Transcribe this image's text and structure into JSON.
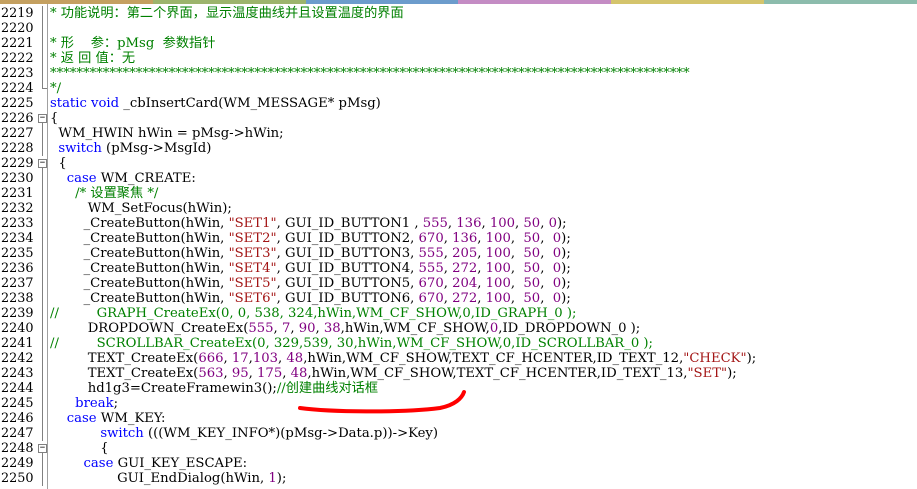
{
  "colors": {
    "comment": "#008000",
    "keyword": "#0000ff",
    "string": "#a31515",
    "number": "#800080",
    "plain": "#000000",
    "annotation": "#ff0000",
    "gutter_line": "#808080"
  },
  "top_strip_colors": [
    "#c4a060",
    "#9cb46c",
    "#6c9ccc",
    "#c48cc4",
    "#d4c46c",
    "#8cbcac"
  ],
  "lines": [
    {
      "n": "2219",
      "fold": "line",
      "segs": [
        [
          "* 功能说明：第二个界面，显示温度曲线并且设置温度的界面",
          "com"
        ]
      ]
    },
    {
      "n": "2220",
      "fold": "line",
      "segs": []
    },
    {
      "n": "2221",
      "fold": "line",
      "segs": [
        [
          "* 形    参：pMsg  参数指针",
          "com"
        ]
      ]
    },
    {
      "n": "2222",
      "fold": "line",
      "segs": [
        [
          "* 返 回 值：无",
          "com"
        ]
      ]
    },
    {
      "n": "2223",
      "fold": "line",
      "segs": [
        [
          "*************************************************************************************************",
          "com"
        ]
      ]
    },
    {
      "n": "2224",
      "fold": "end",
      "segs": [
        [
          "*/",
          "com"
        ]
      ]
    },
    {
      "n": "2225",
      "fold": "none",
      "segs": [
        [
          "static void ",
          "kw"
        ],
        [
          "_cbInsertCard(WM_MESSAGE* pMsg)",
          "pl"
        ]
      ]
    },
    {
      "n": "2226",
      "fold": "box",
      "segs": [
        [
          "{",
          "pl"
        ]
      ]
    },
    {
      "n": "2227",
      "fold": "line",
      "segs": [
        [
          "  WM_HWIN hWin = pMsg->hWin;",
          "pl"
        ]
      ]
    },
    {
      "n": "2228",
      "fold": "line",
      "segs": [
        [
          "  ",
          "pl"
        ],
        [
          "switch ",
          "kw"
        ],
        [
          "(pMsg->MsgId)",
          "pl"
        ]
      ]
    },
    {
      "n": "2229",
      "fold": "box",
      "segs": [
        [
          "  {",
          "pl"
        ]
      ]
    },
    {
      "n": "2230",
      "fold": "line",
      "segs": [
        [
          "    ",
          "pl"
        ],
        [
          "case ",
          "kw"
        ],
        [
          "WM_CREATE:",
          "pl"
        ]
      ]
    },
    {
      "n": "2231",
      "fold": "line",
      "segs": [
        [
          "      /* 设置聚焦 */",
          "com"
        ]
      ]
    },
    {
      "n": "2232",
      "fold": "line",
      "segs": [
        [
          "         WM_SetFocus(hWin);",
          "pl"
        ]
      ]
    },
    {
      "n": "2233",
      "fold": "line",
      "segs": [
        [
          "        _CreateButton(hWin, ",
          "pl"
        ],
        [
          "\"SET1\"",
          "str"
        ],
        [
          ", GUI_ID_BUTTON1 , ",
          "pl"
        ],
        [
          "555",
          "num"
        ],
        [
          ", ",
          "pl"
        ],
        [
          "136",
          "num"
        ],
        [
          ", ",
          "pl"
        ],
        [
          "100",
          "num"
        ],
        [
          ", ",
          "pl"
        ],
        [
          "50",
          "num"
        ],
        [
          ", ",
          "pl"
        ],
        [
          "0",
          "num"
        ],
        [
          ");",
          "pl"
        ]
      ]
    },
    {
      "n": "2234",
      "fold": "line",
      "segs": [
        [
          "        _CreateButton(hWin, ",
          "pl"
        ],
        [
          "\"SET2\"",
          "str"
        ],
        [
          ", GUI_ID_BUTTON2, ",
          "pl"
        ],
        [
          "670",
          "num"
        ],
        [
          ", ",
          "pl"
        ],
        [
          "136",
          "num"
        ],
        [
          ", ",
          "pl"
        ],
        [
          "100",
          "num"
        ],
        [
          ",  ",
          "pl"
        ],
        [
          "50",
          "num"
        ],
        [
          ",  ",
          "pl"
        ],
        [
          "0",
          "num"
        ],
        [
          ");",
          "pl"
        ]
      ]
    },
    {
      "n": "2235",
      "fold": "line",
      "segs": [
        [
          "        _CreateButton(hWin, ",
          "pl"
        ],
        [
          "\"SET3\"",
          "str"
        ],
        [
          ", GUI_ID_BUTTON3, ",
          "pl"
        ],
        [
          "555",
          "num"
        ],
        [
          ", ",
          "pl"
        ],
        [
          "205",
          "num"
        ],
        [
          ", ",
          "pl"
        ],
        [
          "100",
          "num"
        ],
        [
          ",  ",
          "pl"
        ],
        [
          "50",
          "num"
        ],
        [
          ",  ",
          "pl"
        ],
        [
          "0",
          "num"
        ],
        [
          ");",
          "pl"
        ]
      ]
    },
    {
      "n": "2236",
      "fold": "line",
      "segs": [
        [
          "        _CreateButton(hWin, ",
          "pl"
        ],
        [
          "\"SET4\"",
          "str"
        ],
        [
          ", GUI_ID_BUTTON4, ",
          "pl"
        ],
        [
          "555",
          "num"
        ],
        [
          ", ",
          "pl"
        ],
        [
          "272",
          "num"
        ],
        [
          ", ",
          "pl"
        ],
        [
          "100",
          "num"
        ],
        [
          ",  ",
          "pl"
        ],
        [
          "50",
          "num"
        ],
        [
          ",  ",
          "pl"
        ],
        [
          "0",
          "num"
        ],
        [
          ");",
          "pl"
        ]
      ]
    },
    {
      "n": "2237",
      "fold": "line",
      "segs": [
        [
          "        _CreateButton(hWin, ",
          "pl"
        ],
        [
          "\"SET5\"",
          "str"
        ],
        [
          ", GUI_ID_BUTTON5, ",
          "pl"
        ],
        [
          "670",
          "num"
        ],
        [
          ", ",
          "pl"
        ],
        [
          "204",
          "num"
        ],
        [
          ", ",
          "pl"
        ],
        [
          "100",
          "num"
        ],
        [
          ",  ",
          "pl"
        ],
        [
          "50",
          "num"
        ],
        [
          ",  ",
          "pl"
        ],
        [
          "0",
          "num"
        ],
        [
          ");",
          "pl"
        ]
      ]
    },
    {
      "n": "2238",
      "fold": "line",
      "segs": [
        [
          "        _CreateButton(hWin, ",
          "pl"
        ],
        [
          "\"SET6\"",
          "str"
        ],
        [
          ", GUI_ID_BUTTON6, ",
          "pl"
        ],
        [
          "670",
          "num"
        ],
        [
          ", ",
          "pl"
        ],
        [
          "272",
          "num"
        ],
        [
          ", ",
          "pl"
        ],
        [
          "100",
          "num"
        ],
        [
          ",  ",
          "pl"
        ],
        [
          "50",
          "num"
        ],
        [
          ",  ",
          "pl"
        ],
        [
          "0",
          "num"
        ],
        [
          ");",
          "pl"
        ]
      ]
    },
    {
      "n": "2239",
      "fold": "line",
      "segs": [
        [
          "//         GRAPH_CreateEx(0, 0, 538, 324,hWin,WM_CF_SHOW,0,ID_GRAPH_0 );",
          "com"
        ]
      ]
    },
    {
      "n": "2240",
      "fold": "line",
      "segs": [
        [
          "         DROPDOWN_CreateEx(",
          "pl"
        ],
        [
          "555",
          "num"
        ],
        [
          ", ",
          "pl"
        ],
        [
          "7",
          "num"
        ],
        [
          ", ",
          "pl"
        ],
        [
          "90",
          "num"
        ],
        [
          ", ",
          "pl"
        ],
        [
          "38",
          "num"
        ],
        [
          ",hWin,WM_CF_SHOW,",
          "pl"
        ],
        [
          "0",
          "num"
        ],
        [
          ",ID_DROPDOWN_0 );",
          "pl"
        ]
      ]
    },
    {
      "n": "2241",
      "fold": "line",
      "segs": [
        [
          "//         SCROLLBAR_CreateEx(0, 329,539, 30,hWin,WM_CF_SHOW,0,ID_SCROLLBAR_0 );",
          "com"
        ]
      ]
    },
    {
      "n": "2242",
      "fold": "line",
      "segs": [
        [
          "         TEXT_CreateEx(",
          "pl"
        ],
        [
          "666",
          "num"
        ],
        [
          ", ",
          "pl"
        ],
        [
          "17",
          "num"
        ],
        [
          ",",
          "pl"
        ],
        [
          "103",
          "num"
        ],
        [
          ", ",
          "pl"
        ],
        [
          "48",
          "num"
        ],
        [
          ",hWin,WM_CF_SHOW,TEXT_CF_HCENTER,ID_TEXT_12,",
          "pl"
        ],
        [
          "\"CHECK\"",
          "str"
        ],
        [
          ");",
          "pl"
        ]
      ]
    },
    {
      "n": "2243",
      "fold": "line",
      "segs": [
        [
          "         TEXT_CreateEx(",
          "pl"
        ],
        [
          "563",
          "num"
        ],
        [
          ", ",
          "pl"
        ],
        [
          "95",
          "num"
        ],
        [
          ", ",
          "pl"
        ],
        [
          "175",
          "num"
        ],
        [
          ", ",
          "pl"
        ],
        [
          "48",
          "num"
        ],
        [
          ",hWin,WM_CF_SHOW,TEXT_CF_HCENTER,ID_TEXT_13,",
          "pl"
        ],
        [
          "\"SET\"",
          "str"
        ],
        [
          ");",
          "pl"
        ]
      ]
    },
    {
      "n": "2244",
      "fold": "line",
      "segs": [
        [
          "         hd1g3=CreateFramewin3();",
          "pl"
        ],
        [
          "//创建曲线对话框",
          "com"
        ]
      ]
    },
    {
      "n": "2245",
      "fold": "line",
      "segs": [
        [
          "      ",
          "pl"
        ],
        [
          "break",
          "kw"
        ],
        [
          ";",
          "pl"
        ]
      ]
    },
    {
      "n": "2246",
      "fold": "line",
      "segs": [
        [
          "    ",
          "pl"
        ],
        [
          "case ",
          "kw"
        ],
        [
          "WM_KEY:",
          "pl"
        ]
      ]
    },
    {
      "n": "2247",
      "fold": "line",
      "segs": [
        [
          "            ",
          "pl"
        ],
        [
          "switch ",
          "kw"
        ],
        [
          "(((WM_KEY_INFO*)(pMsg->Data.p))->Key)",
          "pl"
        ]
      ]
    },
    {
      "n": "2248",
      "fold": "box",
      "segs": [
        [
          "            {",
          "pl"
        ]
      ]
    },
    {
      "n": "2249",
      "fold": "line",
      "segs": [
        [
          "        ",
          "pl"
        ],
        [
          "case ",
          "kw"
        ],
        [
          "GUI_KEY_ESCAPE:",
          "pl"
        ]
      ]
    },
    {
      "n": "2250",
      "fold": "line",
      "segs": [
        [
          "                GUI_EndDialog(hWin, ",
          "pl"
        ],
        [
          "1",
          "num"
        ],
        [
          ");",
          "pl"
        ]
      ]
    }
  ]
}
